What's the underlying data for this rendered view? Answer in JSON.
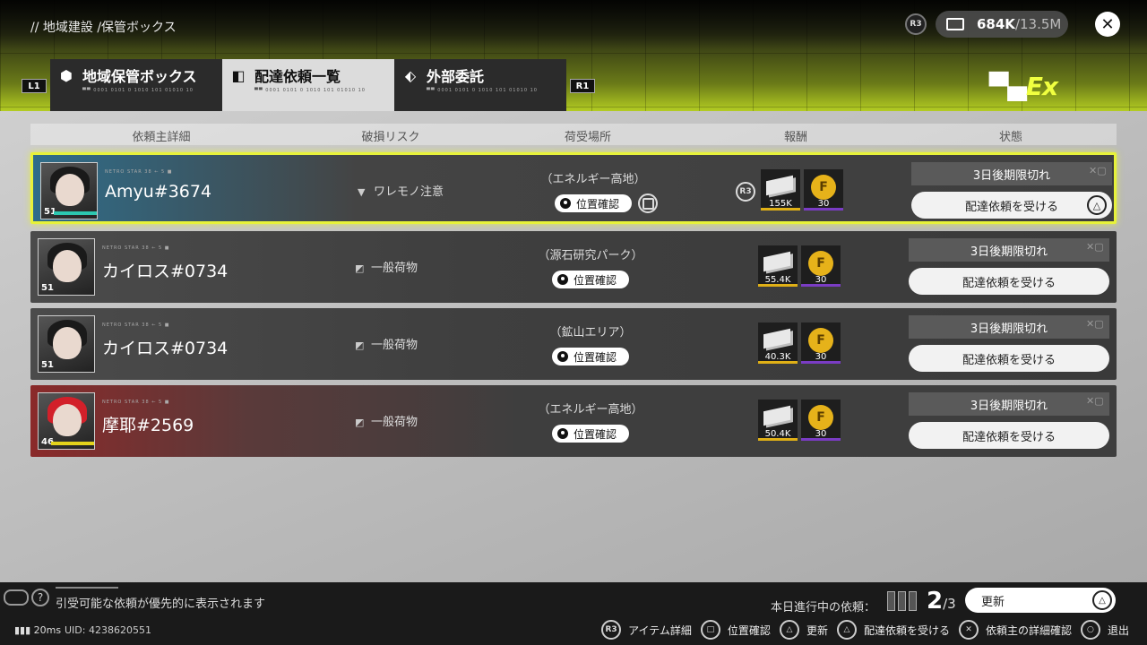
{
  "breadcrumb": "// 地域建設 /保管ボックス",
  "topbar": {
    "r3": "R3",
    "currency_main": "684K",
    "currency_sep": "/13.5M",
    "close_icon": "cross-icon"
  },
  "tabs": {
    "left_trigger": "L1",
    "right_trigger": "R1",
    "items": [
      {
        "label": "地域保管ボックス",
        "code": "▀▀ 0001 0101 0 1010 101 01010 10"
      },
      {
        "label": "配達依頼一覧",
        "code": "▀▀ 0001 0101 0 1010 101 01010 10"
      },
      {
        "label": "外部委託",
        "code": "▀▀ 0001 0101 0 1010 101 01010 10"
      }
    ]
  },
  "logo": {
    "a": "▀▄",
    "b": "Ex"
  },
  "columns": {
    "client": "依頼主詳細",
    "risk": "破損リスク",
    "place": "荷受場所",
    "reward": "報酬",
    "status": "状態"
  },
  "rows": [
    {
      "name": "Amyu#3674",
      "tag": "NETRO STAR 38 ← 5 ■",
      "level": "51",
      "risk": "ワレモノ注意",
      "place": "（エネルギー高地）",
      "locate": "位置確認",
      "r3": "R3",
      "reward_money": "155K",
      "reward_coin": "30",
      "deadline": "3日後期限切れ",
      "accept": "配達依頼を受ける",
      "selected": true
    },
    {
      "name": "カイロス#0734",
      "tag": "NETRO STAR 38 ← 5 ■",
      "level": "51",
      "risk": "一般荷物",
      "place": "（源石研究パーク）",
      "locate": "位置確認",
      "reward_money": "55.4K",
      "reward_coin": "30",
      "deadline": "3日後期限切れ",
      "accept": "配達依頼を受ける"
    },
    {
      "name": "カイロス#0734",
      "tag": "NETRO STAR 38 ← 5 ■",
      "level": "51",
      "risk": "一般荷物",
      "place": "（鉱山エリア）",
      "locate": "位置確認",
      "reward_money": "40.3K",
      "reward_coin": "30",
      "deadline": "3日後期限切れ",
      "accept": "配達依頼を受ける"
    },
    {
      "name": "摩耶#2569",
      "tag": "NETRO STAR 38 ← 5 ■",
      "level": "46",
      "risk": "一般荷物",
      "place": "（エネルギー高地）",
      "locate": "位置確認",
      "reward_money": "50.4K",
      "reward_coin": "30",
      "deadline": "3日後期限切れ",
      "accept": "配達依頼を受ける"
    }
  ],
  "footer": {
    "hint": "引受可能な依頼が優先的に表示されます",
    "ping": "20ms",
    "uid": "UID: 4238620551",
    "progress_label": "本日進行中の依頼：",
    "progress_current": "2",
    "progress_total": "/3",
    "progress_value": 0.667,
    "refresh": "更新",
    "controls": [
      {
        "button": "R3",
        "label": "アイテム詳細"
      },
      {
        "button": "□",
        "label": "位置確認"
      },
      {
        "button": "△",
        "label": "更新"
      },
      {
        "button": "△",
        "label": "配達依頼を受ける"
      },
      {
        "button": "✕",
        "label": "依頼主の詳細確認"
      },
      {
        "button": "○",
        "label": "退出"
      }
    ]
  }
}
